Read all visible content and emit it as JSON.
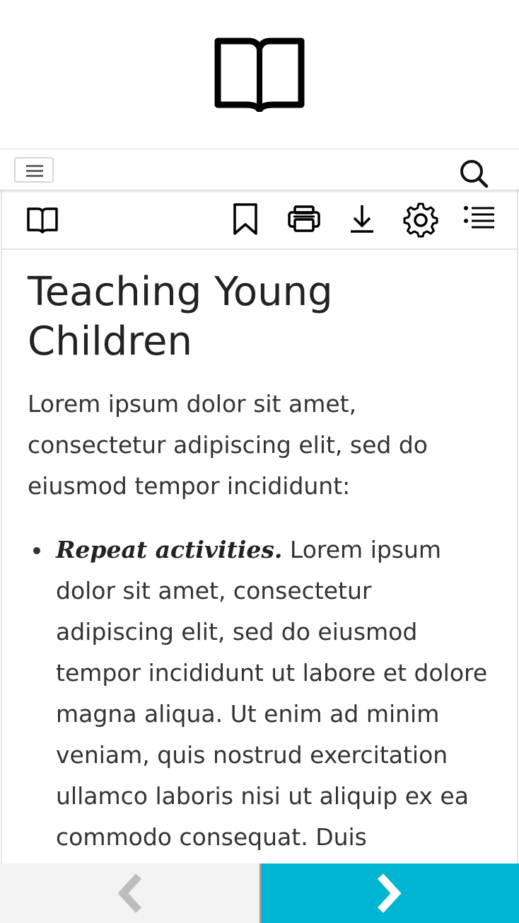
{
  "header": {
    "logo_icon": "open-book-icon",
    "menu_icon": "hamburger-icon",
    "search_icon": "search-icon"
  },
  "toolbar": {
    "icons": [
      "open-book-icon",
      "bookmark-icon",
      "print-icon",
      "download-icon",
      "gear-icon",
      "list-icon"
    ]
  },
  "article": {
    "title": "Teaching Young Children",
    "intro": "Lorem ipsum dolor sit amet, consectetur adipiscing elit, sed do eiusmod tempor incididunt:",
    "items": [
      {
        "title": "Repeat activities.",
        "text": " Lorem ipsum dolor sit amet, consectetur adipiscing elit, sed do eiusmod tempor incididunt ut labore et dolore magna aliqua. Ut enim ad minim veniam, quis nostrud exercitation ullamco laboris nisi ut aliquip ex ea commodo consequat. Duis"
      }
    ]
  },
  "navigation": {
    "prev_icon": "chevron-left-icon",
    "next_icon": "chevron-right-icon",
    "next_color": "#00b5d1"
  }
}
